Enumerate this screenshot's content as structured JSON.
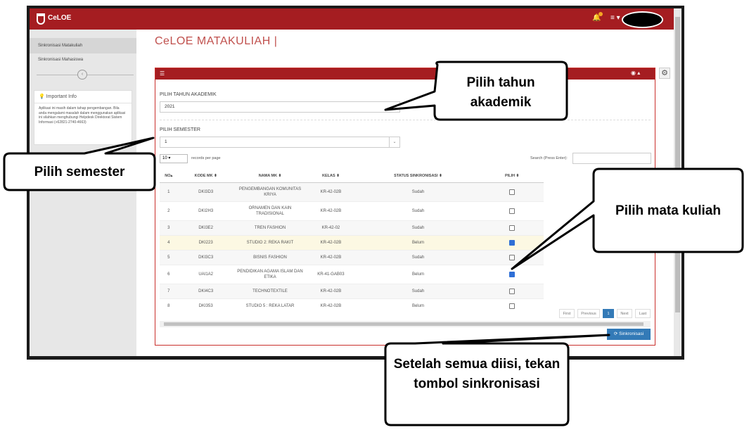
{
  "app": {
    "name": "CeLOE"
  },
  "sidebar": {
    "items": [
      {
        "label": "Sinkronisasi Matakuliah"
      },
      {
        "label": "Sinkronisasi Mahasiswa"
      }
    ],
    "toggle_glyph": "‹",
    "info_title": "Important Info",
    "info_text": "Aplikasi ini masih dalam tahap pengembangan. Bila anda mengalami masalah dalam menggunakan aplikasi ini silahkan menghubungi Helpdesk Direktorat Sistem Informasi (+62821-2740-4663)"
  },
  "page": {
    "title": "CeLOE MATAKULIAH |"
  },
  "form": {
    "tahun_label": "PILIH TAHUN AKADEMIK",
    "tahun_value": "2021",
    "semester_label": "PILIH SEMESTER",
    "semester_value": "1"
  },
  "table_controls": {
    "page_size": "10",
    "records_label": "records per page",
    "search_label": "Search (Press Enter):"
  },
  "table": {
    "headers": [
      "NO",
      "KODE MK",
      "NAMA MK",
      "KELAS",
      "STATUS SINKRONISASI",
      "PILIH"
    ],
    "rows": [
      {
        "no": "1",
        "kode": "DKI3D3",
        "nama": "PENGEMBANGAN KOMUNITAS KRIYA",
        "kelas": "KR-42-02B",
        "status": "Sudah",
        "checked": false
      },
      {
        "no": "2",
        "kode": "DKI2H3",
        "nama": "ORNAMEN DAN KAIN TRADISIONAL",
        "kelas": "KR-42-02B",
        "status": "Sudah",
        "checked": false
      },
      {
        "no": "3",
        "kode": "DKI3E2",
        "nama": "TREN FASHION",
        "kelas": "KR-42-02",
        "status": "Sudah",
        "checked": false
      },
      {
        "no": "4",
        "kode": "DKI223",
        "nama": "STUDIO 2: REKA RAKIT",
        "kelas": "KR-42-02B",
        "status": "Belum",
        "checked": true
      },
      {
        "no": "5",
        "kode": "DKI3C3",
        "nama": "BISNIS FASHION",
        "kelas": "KR-42-02B",
        "status": "Sudah",
        "checked": false
      },
      {
        "no": "6",
        "kode": "UAI1A2",
        "nama": "PENDIDIKAN AGAMA ISLAM DAN ETIKA",
        "kelas": "KR-41-GAB03",
        "status": "Belum",
        "checked": true
      },
      {
        "no": "7",
        "kode": "DKI4C3",
        "nama": "TECHNOTEXTILE",
        "kelas": "KR-42-02B",
        "status": "Sudah",
        "checked": false
      },
      {
        "no": "8",
        "kode": "DKI353",
        "nama": "STUDIO 5 : REKA LATAR",
        "kelas": "KR-42-02B",
        "status": "Belum",
        "checked": false
      }
    ]
  },
  "pagination": {
    "first": "First",
    "previous": "Previous",
    "current": "1",
    "next": "Next",
    "last": "Last"
  },
  "sync_button": {
    "label": "Sinkronisasi"
  },
  "callouts": {
    "tahun": "Pilih tahun akademik",
    "semester": "Pilih semester",
    "matkul": "Pilih mata kuliah",
    "sync": "Setelah semua diisi, tekan tombol sinkronisasi"
  },
  "colors": {
    "brand": "#a51d21",
    "button": "#337ab7",
    "highlight_row": "#fcf8e3"
  }
}
